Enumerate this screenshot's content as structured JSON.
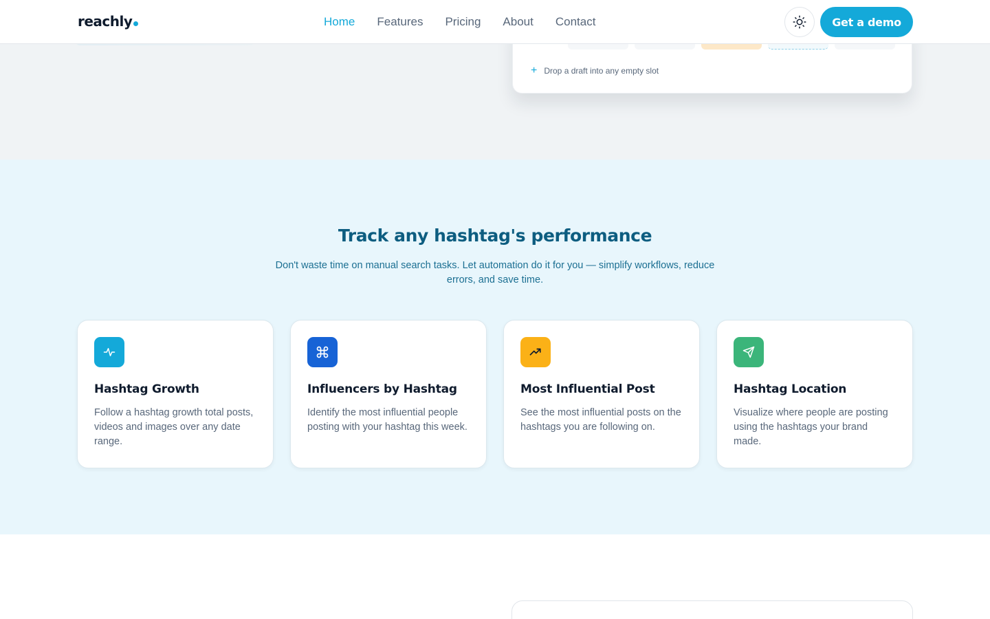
{
  "header": {
    "logo": "reachly",
    "nav": [
      {
        "label": "Home",
        "active": true
      },
      {
        "label": "Features",
        "active": false
      },
      {
        "label": "Pricing",
        "active": false
      },
      {
        "label": "About",
        "active": false
      },
      {
        "label": "Contact",
        "active": false
      }
    ],
    "theme_toggle_icon": "sun-icon",
    "cta_label": "Get a demo"
  },
  "calendar_preview": {
    "drop_hint": "Drop a draft into any empty slot"
  },
  "hashtag_section": {
    "title": "Track any hashtag's performance",
    "subtitle": "Don't waste time on manual search tasks. Let automation do it for you — simplify workflows, reduce errors, and save time.",
    "cards": [
      {
        "icon": "activity-icon",
        "icon_color": "#14a9d9",
        "title": "Hashtag Growth",
        "description": "Follow a hashtag growth total posts, videos and images over any date range."
      },
      {
        "icon": "command-icon",
        "icon_color": "#1763d6",
        "title": "Influencers by Hashtag",
        "description": "Identify the most influential people posting with your hashtag this week."
      },
      {
        "icon": "trending-up-icon",
        "icon_color": "#fbb117",
        "title": "Most Influential Post",
        "description": "See the most influential posts on the hashtags you are following on."
      },
      {
        "icon": "send-icon",
        "icon_color": "#3bb57a",
        "title": "Hashtag Location",
        "description": "Visualize where people are posting using the hashtags your brand made."
      }
    ]
  },
  "colors": {
    "accent": "#14a9d9",
    "heading_dark": "#0d5d80",
    "section_bg": "#e8f6fc"
  }
}
